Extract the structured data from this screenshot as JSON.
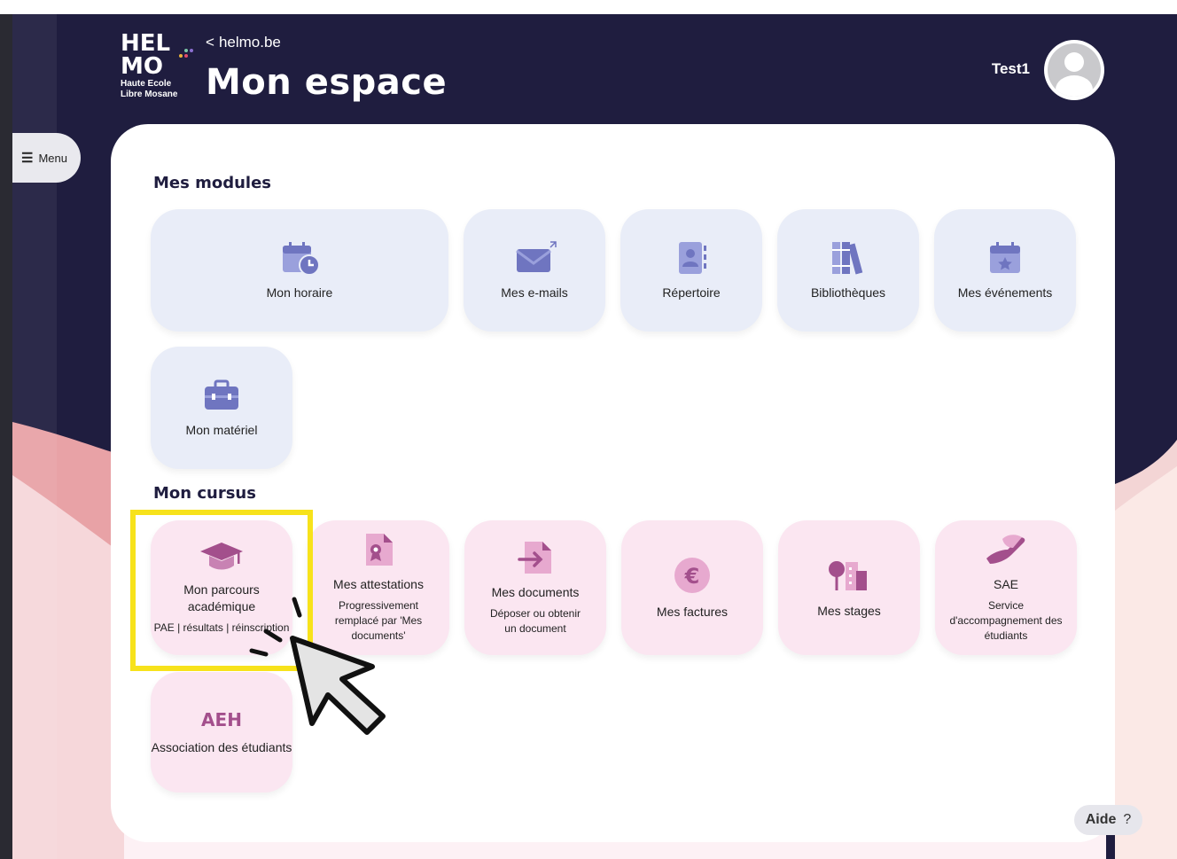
{
  "header": {
    "back_link": "helmo.be",
    "title": "Mon espace",
    "user_name": "Test1"
  },
  "logo": {
    "line1": "HEL",
    "line2": "MO",
    "line3": "Haute Ecole",
    "line4": "Libre Mosane"
  },
  "menu": {
    "label": "Menu"
  },
  "modules": {
    "title": "Mes modules",
    "items": [
      {
        "label": "Mon horaire",
        "icon": "calendar-clock-icon"
      },
      {
        "label": "Mes e-mails",
        "icon": "envelope-external-icon"
      },
      {
        "label": "Répertoire",
        "icon": "contact-book-icon"
      },
      {
        "label": "Bibliothèques",
        "icon": "books-icon"
      },
      {
        "label": "Mes événements",
        "icon": "calendar-star-icon"
      },
      {
        "label": "Mon matériel",
        "icon": "toolbox-icon"
      }
    ]
  },
  "cursus": {
    "title": "Mon cursus",
    "items": [
      {
        "label": "Mon parcours académique",
        "sub": "PAE | résultats | réinscription",
        "icon": "graduation-cap-icon"
      },
      {
        "label": "Mes attestations",
        "sub": "Progressivement remplacé par 'Mes documents'",
        "icon": "certificate-file-icon"
      },
      {
        "label": "Mes documents",
        "sub": "Déposer ou obtenir un document",
        "icon": "file-arrow-icon"
      },
      {
        "label": "Mes factures",
        "sub": "",
        "icon": "euro-icon"
      },
      {
        "label": "Mes stages",
        "sub": "",
        "icon": "tree-building-icon"
      },
      {
        "label": "SAE",
        "sub": "Service d'accompagnement des étudiants",
        "icon": "helping-hand-icon"
      },
      {
        "label": "Association des étudiants",
        "sub": "",
        "badge": "AEH"
      }
    ]
  },
  "help": {
    "label": "Aide",
    "icon": "question-icon"
  },
  "colors": {
    "header_bg": "#1f1d3f",
    "module_tile": "#e9edf8",
    "cursus_tile": "#fbe6f1",
    "icon_blue": "#6f75c0",
    "icon_pink": "#a34f8c",
    "highlight": "#f7e21b"
  }
}
